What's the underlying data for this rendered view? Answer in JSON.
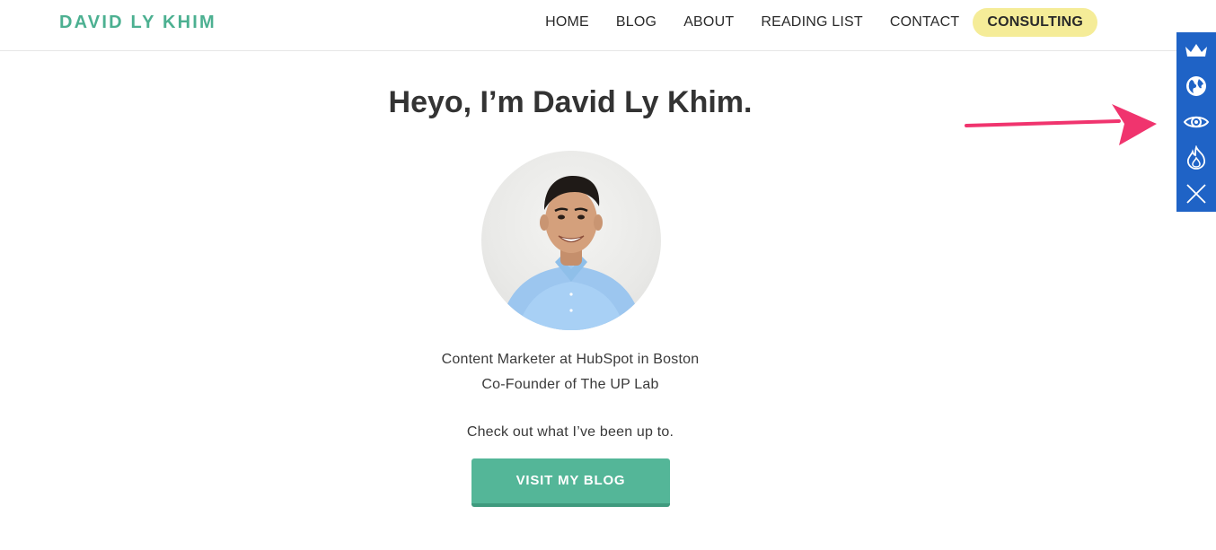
{
  "header": {
    "logo": "DAVID LY KHIM",
    "nav": [
      {
        "label": "HOME"
      },
      {
        "label": "BLOG"
      },
      {
        "label": "ABOUT"
      },
      {
        "label": "READING LIST"
      },
      {
        "label": "CONTACT"
      },
      {
        "label": "CONSULTING"
      }
    ]
  },
  "hero": {
    "title": "Heyo, I’m David Ly Khim.",
    "role_line1": "Content Marketer at HubSpot in Boston",
    "role_line2": "Co-Founder of The UP Lab",
    "prompt": "Check out what I’ve been up to.",
    "cta_label": "VISIT MY BLOG"
  },
  "toolbar": {
    "icons": [
      "crown-icon",
      "globe-icon",
      "eye-icon",
      "flame-icon",
      "close-icon"
    ]
  },
  "colors": {
    "brand_green": "#4cb091",
    "button_green": "#54b698",
    "consulting_highlight": "#f5ec98",
    "toolbar_blue": "#1f63c6",
    "annotation_arrow": "#f0346e"
  }
}
